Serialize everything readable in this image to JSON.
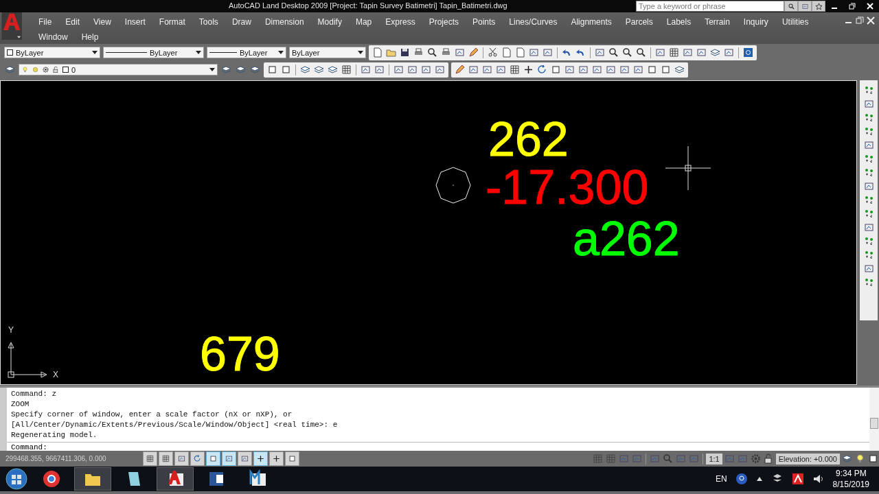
{
  "window": {
    "title": "AutoCAD Land Desktop 2009 [Project: Tapin Survey Batimetri]",
    "file": "Tapin_Batimetri.dwg"
  },
  "search": {
    "placeholder": "Type a keyword or phrase"
  },
  "menu": [
    "File",
    "Edit",
    "View",
    "Insert",
    "Format",
    "Tools",
    "Draw",
    "Dimension",
    "Modify",
    "Map",
    "Express",
    "Projects",
    "Points",
    "Lines/Curves",
    "Alignments",
    "Parcels",
    "Labels",
    "Terrain",
    "Inquiry",
    "Utilities",
    "Window",
    "Help"
  ],
  "properties": [
    "ByLayer",
    "ByLayer",
    "ByLayer",
    "ByLayer"
  ],
  "layer": {
    "name": "0"
  },
  "drawing": {
    "labels": [
      {
        "text": "262",
        "color": "#ffff00"
      },
      {
        "text": "-17.300",
        "color": "#ff0000"
      },
      {
        "text": "a262",
        "color": "#00ff00"
      },
      {
        "text": "679",
        "color": "#ffff00"
      }
    ],
    "axis_y": "Y",
    "axis_x": "X"
  },
  "command": {
    "lines": [
      "Command: z",
      "ZOOM",
      "Specify corner of window, enter a scale factor (nX or nXP), or",
      "[All/Center/Dynamic/Extents/Previous/Scale/Window/Object] <real time>: e",
      "Regenerating model."
    ],
    "prompt": "Command:"
  },
  "status": {
    "coordinates": "299468.355, 9667411.306, 0.000",
    "toggles": [
      {
        "on": false
      },
      {
        "on": false
      },
      {
        "on": false
      },
      {
        "on": false
      },
      {
        "on": true
      },
      {
        "on": true
      },
      {
        "on": false
      },
      {
        "on": true
      },
      {
        "on": false
      },
      {
        "on": false
      }
    ],
    "scale": "1:1",
    "elevation": "Elevation:  +0.000"
  },
  "taskbar": {
    "language": "EN",
    "time": "9:34 PM",
    "date": "8/15/2019"
  }
}
